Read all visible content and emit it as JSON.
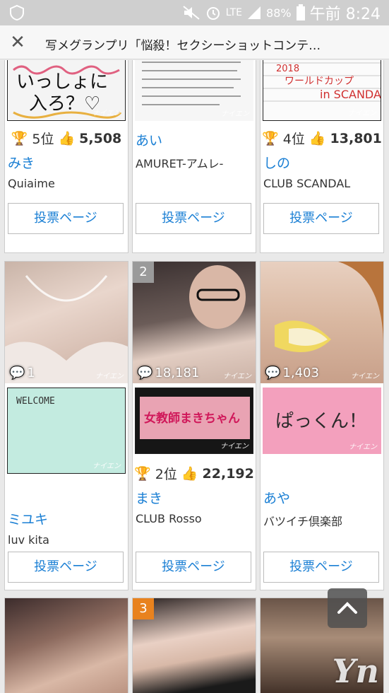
{
  "status_bar": {
    "mute_icon": "mute-icon",
    "alarm_icon": "alarm-icon",
    "network": "LTE",
    "battery": "88%",
    "time": "午前 8:24"
  },
  "toolbar": {
    "title": "写メグランプリ「悩殺！セクシーショットコンテ…"
  },
  "watermark": "ナイエン",
  "vote_label": "投票ページ",
  "cards_top": [
    {
      "note_text": "いっしょに 入ろ？♡",
      "rank": "5位",
      "likes": "5,508",
      "name": "みき",
      "club": "Quiaime"
    },
    {
      "note_text": "今回のお店の企画として...",
      "rank": "",
      "likes": "",
      "name": "あい",
      "club": "AMURET-アムレ-"
    },
    {
      "note_text": "2018 ワールドカップ in SCANDAL",
      "rank": "4位",
      "likes": "13,801",
      "name": "しの",
      "club": "CLUB SCANDAL"
    }
  ],
  "cards_mid": [
    {
      "badge": "",
      "comments": "1",
      "note_text": "WELCOME",
      "rank": "",
      "likes": "",
      "name": "ミユキ",
      "club": "luv kita"
    },
    {
      "badge": "2",
      "comments": "18,181",
      "note_text": "女教師まきちゃん",
      "rank": "2位",
      "likes": "22,192",
      "name": "まき",
      "club": "CLUB Rosso"
    },
    {
      "badge": "",
      "comments": "1,403",
      "note_text": "ぱっくん！",
      "rank": "",
      "likes": "",
      "name": "あや",
      "club": "バツイチ倶楽部"
    }
  ],
  "cards_bottom": [
    {
      "badge": ""
    },
    {
      "badge": "3"
    },
    {
      "badge": ""
    }
  ],
  "logo_text": "Yn",
  "colors": {
    "accent": "#1a7fd4",
    "badge_gray": "#9a9a9a",
    "badge_orange": "#e8821e"
  }
}
